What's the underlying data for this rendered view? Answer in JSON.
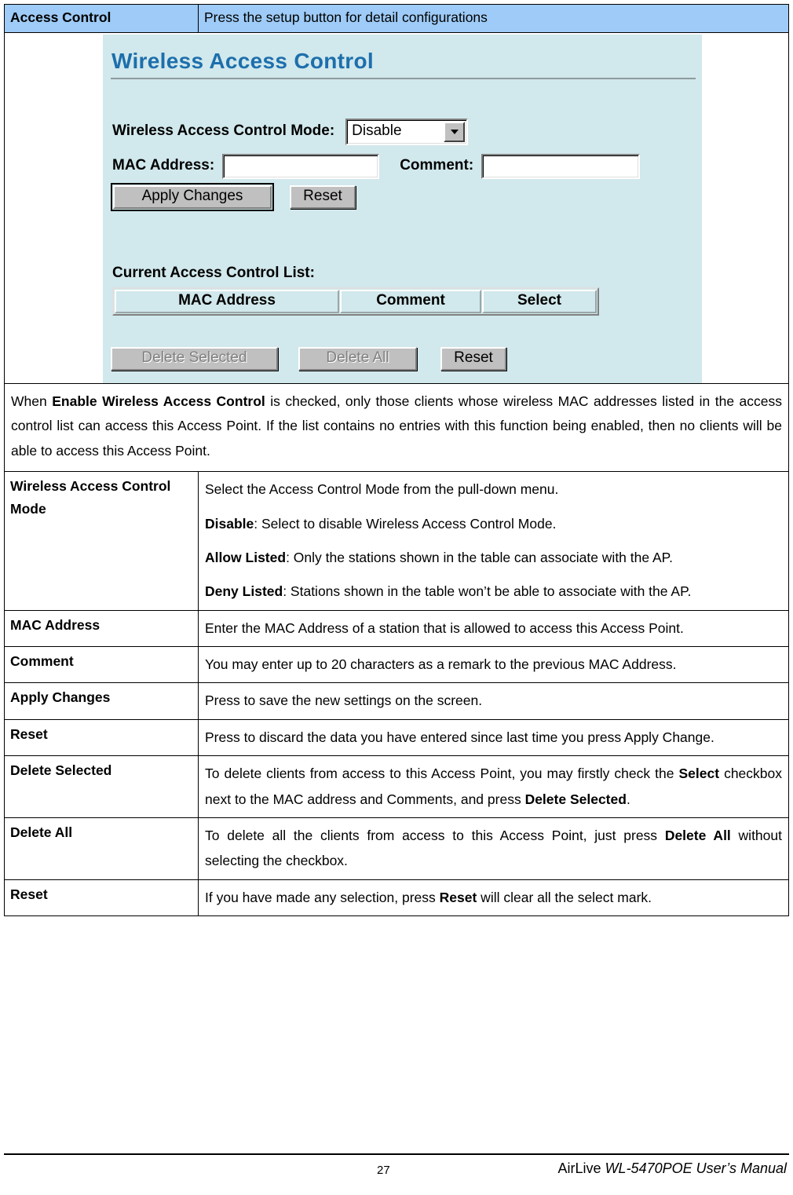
{
  "header": {
    "label": "Access Control",
    "description": "Press the setup button for detail configurations",
    "bg_color": "#9ECBF7"
  },
  "screenshot": {
    "title": "Wireless Access Control",
    "bg_color": "#D1E8EC",
    "title_color": "#1D6FAC",
    "mode_label": "Wireless Access Control Mode:",
    "mode_value": "Disable",
    "mac_label": "MAC Address:",
    "mac_value": "",
    "comment_label": "Comment:",
    "comment_value": "",
    "apply_button": "Apply Changes",
    "reset_button": "Reset",
    "list_label": "Current Access Control List:",
    "list_columns": [
      "MAC Address",
      "Comment",
      "Select"
    ],
    "delete_selected_button": "Delete Selected",
    "delete_all_button": "Delete All",
    "reset_button2": "Reset"
  },
  "intro": {
    "p1_a": "When ",
    "p1_b": "Enable Wireless Access Control",
    "p1_c": " is checked, only those clients whose wireless MAC addresses listed in the access control list can access this Access Point. If the list contains no entries with this function being enabled, then no clients will be able to access this Access Point."
  },
  "rows": [
    {
      "label": "Wireless Access Control Mode",
      "paragraphs": [
        {
          "plain": "Select the Access Control Mode from the pull-down menu."
        },
        {
          "bold": "Disable",
          "rest": ": Select to disable Wireless Access Control Mode."
        },
        {
          "bold": "Allow Listed",
          "rest": ": Only the stations shown in the table can associate with the AP."
        },
        {
          "bold": "Deny Listed",
          "rest": ": Stations shown in the table won’t be able to associate with the AP."
        }
      ]
    },
    {
      "label": "MAC Address",
      "paragraphs": [
        {
          "plain": "Enter the MAC Address of a station that is allowed to access this Access Point."
        }
      ]
    },
    {
      "label": "Comment",
      "paragraphs": [
        {
          "plain": "You may enter up to 20 characters as a remark to the previous MAC Address."
        }
      ]
    },
    {
      "label": "Apply Changes",
      "paragraphs": [
        {
          "plain": "Press to save the new settings on the screen."
        }
      ]
    },
    {
      "label": "Reset",
      "paragraphs": [
        {
          "plain": "Press to discard the data you have entered since last time you press Apply Change."
        }
      ]
    },
    {
      "label": "Delete Selected",
      "paragraphs": [
        {
          "seg": [
            {
              "t": "To delete clients from access to this Access Point, you may firstly check the ",
              "b": false
            },
            {
              "t": "Select",
              "b": true
            },
            {
              "t": " checkbox next to the MAC address and Comments, and press ",
              "b": false
            },
            {
              "t": "Delete Selected",
              "b": true
            },
            {
              "t": ".",
              "b": false
            }
          ]
        }
      ]
    },
    {
      "label": "Delete All",
      "paragraphs": [
        {
          "seg": [
            {
              "t": "To delete all the clients from access to this Access Point, just press ",
              "b": false
            },
            {
              "t": "Delete All",
              "b": true
            },
            {
              "t": " without selecting the checkbox.",
              "b": false
            }
          ]
        }
      ]
    },
    {
      "label": "Reset",
      "paragraphs": [
        {
          "seg": [
            {
              "t": "If you have made any selection, press ",
              "b": false
            },
            {
              "t": "Reset",
              "b": true
            },
            {
              "t": " will clear all the select mark.",
              "b": false
            }
          ]
        }
      ]
    }
  ],
  "footer": {
    "page_number": "27",
    "manual_prefix": "AirLive ",
    "manual_text": "WL-5470POE User’s Manual"
  }
}
